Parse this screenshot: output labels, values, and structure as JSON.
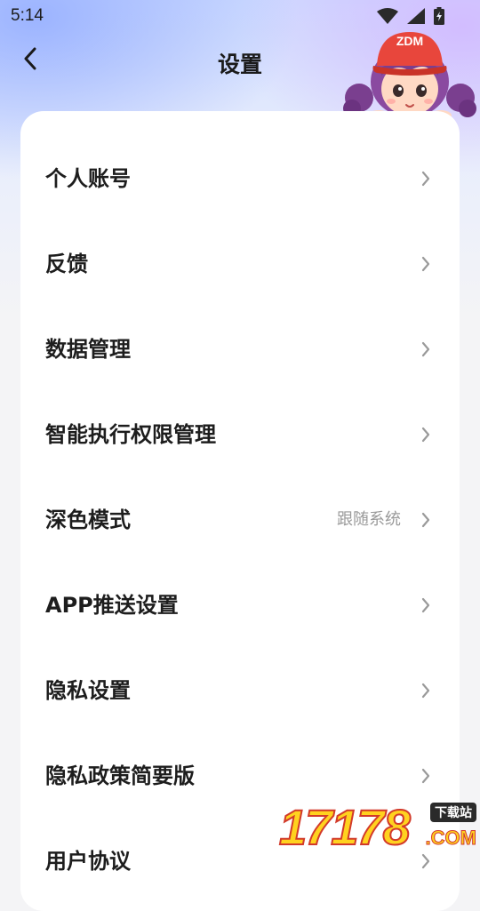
{
  "status_bar": {
    "time": "5:14",
    "icons": [
      "wifi-icon",
      "cellular-signal-icon",
      "battery-charging-icon"
    ]
  },
  "header": {
    "back_icon": "chevron-left-icon",
    "title": "设置"
  },
  "mascot": {
    "cap_text": "ZDM"
  },
  "settings": {
    "items": [
      {
        "label": "个人账号",
        "value": ""
      },
      {
        "label": "反馈",
        "value": ""
      },
      {
        "label": "数据管理",
        "value": ""
      },
      {
        "label": "智能执行权限管理",
        "value": ""
      },
      {
        "label": "深色模式",
        "value": "跟随系统"
      },
      {
        "label": "APP推送设置",
        "value": ""
      },
      {
        "label": "隐私设置",
        "value": ""
      },
      {
        "label": "隐私政策简要版",
        "value": ""
      },
      {
        "label": "用户协议",
        "value": ""
      }
    ]
  },
  "watermark": {
    "number": "17178",
    "domain": ".COM",
    "tag": "下载站"
  },
  "colors": {
    "accent_gradient_left": "#96afff",
    "accent_gradient_right": "#d2b9ff",
    "card_bg": "#ffffff",
    "page_bg": "#f4f4f6",
    "text_primary": "#1d1d1d",
    "text_secondary": "#9a9a9a"
  }
}
